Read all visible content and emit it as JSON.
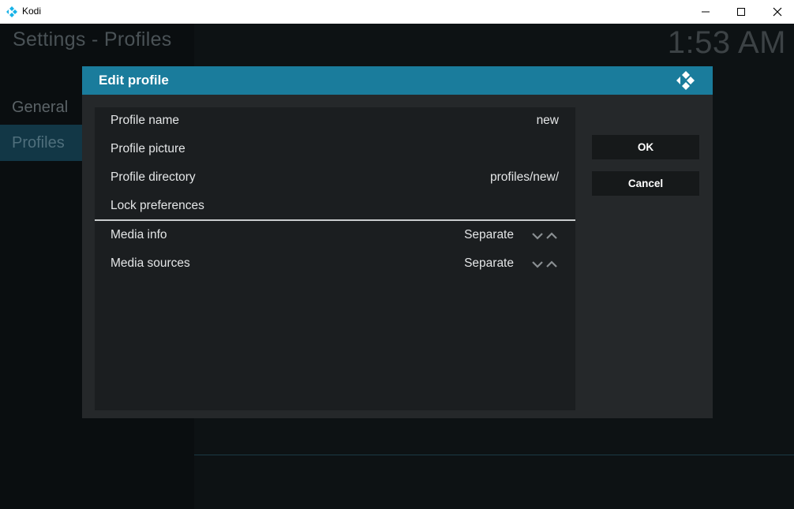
{
  "window": {
    "title": "Kodi",
    "icon": "kodi-logo-icon",
    "controls": [
      "minimize-icon",
      "maximize-icon",
      "close-icon"
    ]
  },
  "screen": {
    "title": "Settings - Profiles",
    "clock": "1:53 AM",
    "sidebar": [
      {
        "label": "General"
      },
      {
        "label": "Profiles",
        "selected": true
      }
    ]
  },
  "dialog": {
    "title": "Edit profile",
    "logo": "kodi-logo-icon",
    "rows": [
      {
        "label": "Profile name",
        "value": "new"
      },
      {
        "label": "Profile picture",
        "value": ""
      },
      {
        "label": "Profile directory",
        "value": "profiles/new/"
      },
      {
        "label": "Lock preferences",
        "value": ""
      },
      {
        "label": "Media info",
        "value": "Separate",
        "control": "spinner-arrows-icon"
      },
      {
        "label": "Media sources",
        "value": "Separate",
        "control": "spinner-arrows-icon"
      }
    ],
    "buttons": {
      "ok": "OK",
      "cancel": "Cancel"
    }
  },
  "colors": {
    "accent": "#1a7c9c",
    "background": "#0d1214",
    "dialog": "#25282a",
    "list": "#1b1e20"
  }
}
